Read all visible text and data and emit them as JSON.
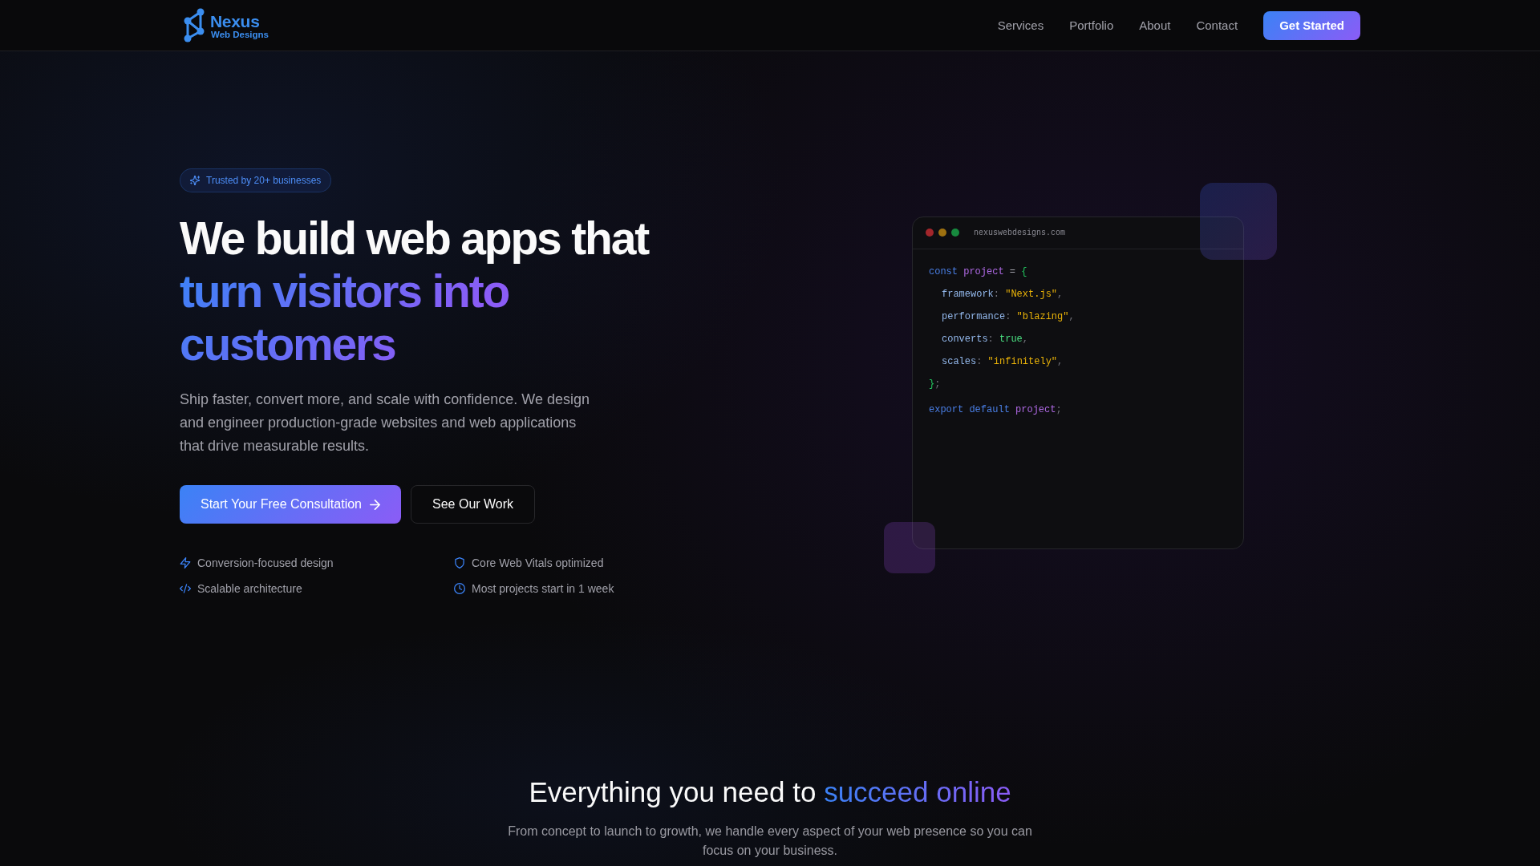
{
  "nav": {
    "logo": {
      "name": "Nexus",
      "tagline": "Web Designs"
    },
    "links": [
      "Services",
      "Portfolio",
      "About",
      "Contact"
    ],
    "cta": "Get Started"
  },
  "hero": {
    "badge": "Trusted by 20+ businesses",
    "headline": "We build web apps that",
    "headline_highlight": "turn visitors into customers",
    "description": "Ship faster, convert more, and scale with confidence. We design and engineer production-grade websites and web applications that drive measurable results.",
    "primary_button": "Start Your Free Consultation",
    "secondary_button": "See Our Work",
    "features": [
      "Conversion-focused design",
      "Core Web Vitals optimized",
      "Scalable architecture",
      "Most projects start in 1 week"
    ]
  },
  "code_window": {
    "url": "nexuswebdesigns.com",
    "lines": [
      {
        "tokens": [
          {
            "text": "const",
            "kind": "keyword"
          },
          {
            "text": " project",
            "kind": "variable"
          },
          {
            "text": " =",
            "kind": "operator"
          },
          {
            "text": " {",
            "kind": "brace"
          }
        ],
        "children": [
          {
            "tokens": [
              {
                "text": "framework",
                "kind": "property"
              },
              {
                "text": ":",
                "kind": "punctuation"
              },
              {
                "text": " \"Next.js\"",
                "kind": "string"
              },
              {
                "text": ",",
                "kind": "punctuation"
              }
            ]
          },
          {
            "tokens": [
              {
                "text": "performance",
                "kind": "property"
              },
              {
                "text": ":",
                "kind": "punctuation"
              },
              {
                "text": " \"blazing\"",
                "kind": "string"
              },
              {
                "text": ",",
                "kind": "punctuation"
              }
            ]
          },
          {
            "tokens": [
              {
                "text": "converts",
                "kind": "property"
              },
              {
                "text": ":",
                "kind": "punctuation"
              },
              {
                "text": " true",
                "kind": "boolean"
              },
              {
                "text": ",",
                "kind": "punctuation"
              }
            ]
          },
          {
            "tokens": [
              {
                "text": "scales",
                "kind": "property"
              },
              {
                "text": ":",
                "kind": "punctuation"
              },
              {
                "text": " \"infinitely\"",
                "kind": "string"
              },
              {
                "text": ",",
                "kind": "punctuation"
              }
            ]
          }
        ]
      },
      {
        "tokens": [
          {
            "text": "}",
            "kind": "brace"
          },
          {
            "text": ";",
            "kind": "punctuation"
          }
        ]
      },
      {
        "tokens": [
          {
            "text": "export",
            "kind": "keyword"
          },
          {
            "text": " default",
            "kind": "keyword"
          },
          {
            "text": " project",
            "kind": "variable"
          },
          {
            "text": ";",
            "kind": "punctuation"
          }
        ]
      }
    ]
  },
  "features_section": {
    "heading": "Everything you need to",
    "heading_highlight": "succeed online",
    "subtitle": "From concept to launch to growth, we handle every aspect of your web presence so you can focus on your business."
  }
}
